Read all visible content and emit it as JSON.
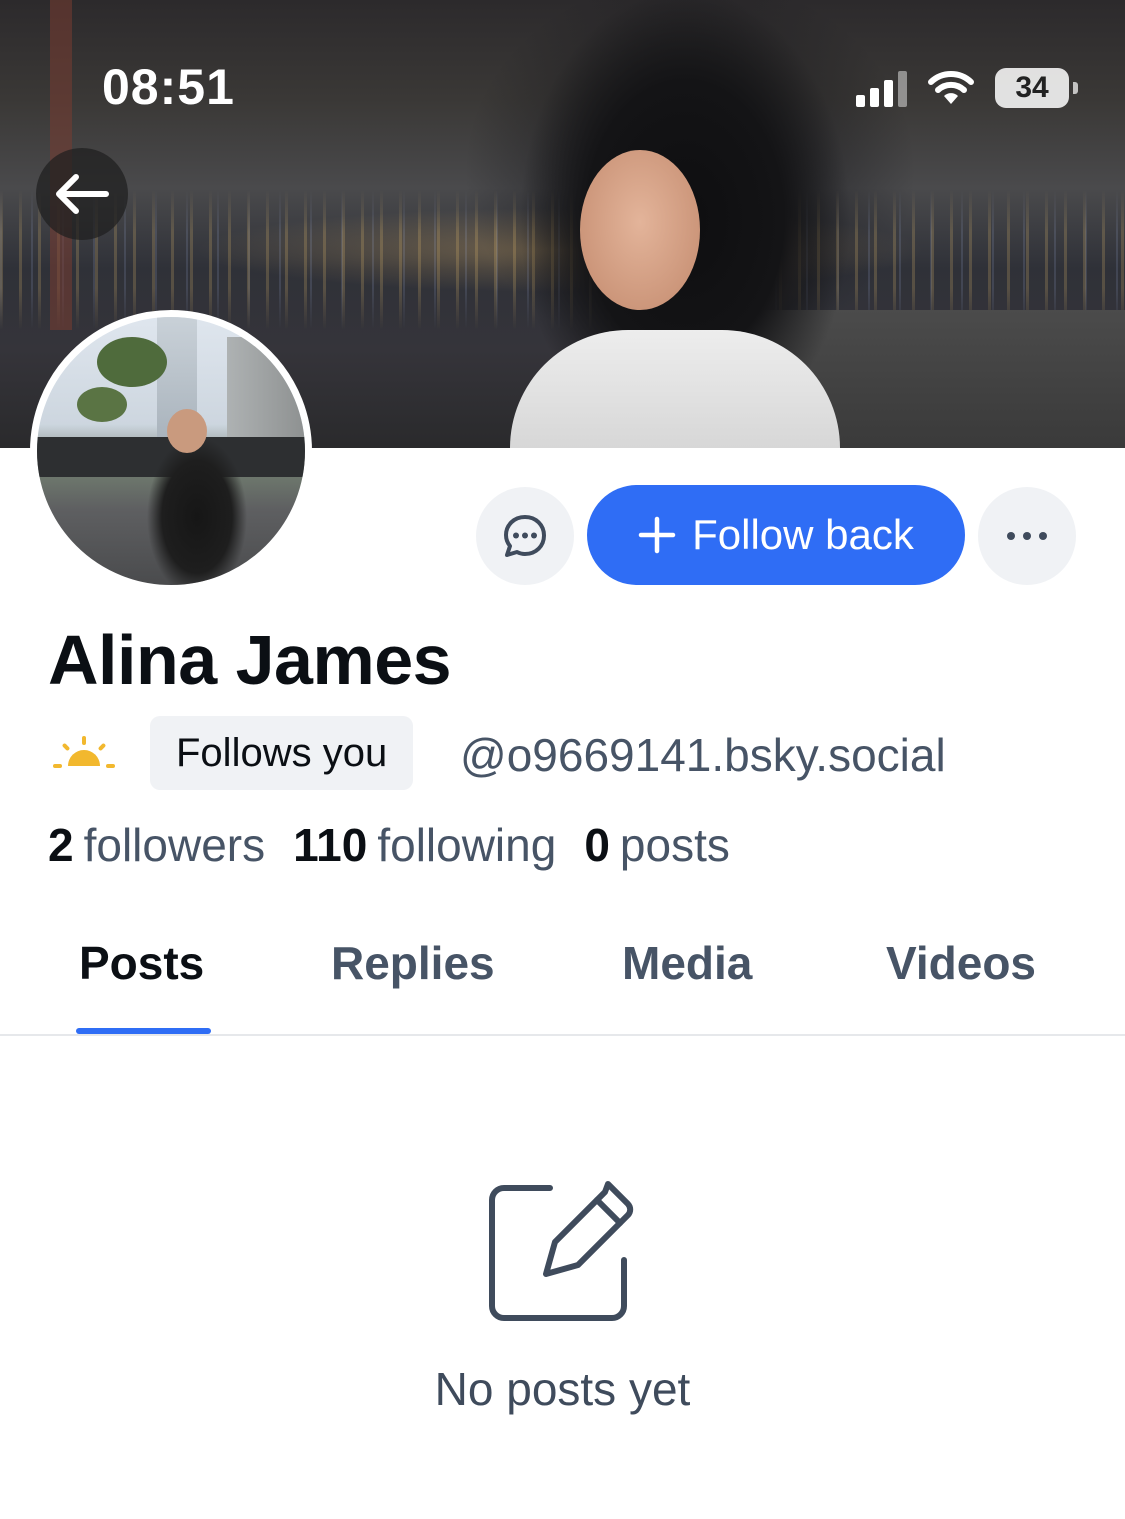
{
  "status_bar": {
    "time": "08:51",
    "battery": "34",
    "icons": [
      "signal-icon",
      "wifi-icon",
      "battery-icon"
    ]
  },
  "navigation": {
    "back_icon": "arrow-left-icon"
  },
  "profile": {
    "display_name": "Alina James",
    "follows_you_label": "Follows you",
    "handle": "@o9669141.bsky.social",
    "badge_icon": "sun-icon",
    "stats": {
      "followers_count": "2",
      "followers_label": "followers",
      "following_count": "110",
      "following_label": "following",
      "posts_count": "0",
      "posts_label": "posts"
    }
  },
  "actions": {
    "message_icon": "chat-bubble-icon",
    "follow_label": "Follow back",
    "follow_icon": "plus-icon",
    "more_icon": "more-horizontal-icon"
  },
  "tabs": [
    {
      "label": "Posts",
      "active": true
    },
    {
      "label": "Replies",
      "active": false
    },
    {
      "label": "Media",
      "active": false
    },
    {
      "label": "Videos",
      "active": false
    }
  ],
  "empty_state": {
    "icon": "compose-icon",
    "text": "No posts yet"
  },
  "colors": {
    "accent": "#2f6df5",
    "text_primary": "#0b0f14",
    "text_secondary": "#475466",
    "chip_background": "#f0f2f5",
    "sun_icon": "#f2b82e"
  }
}
